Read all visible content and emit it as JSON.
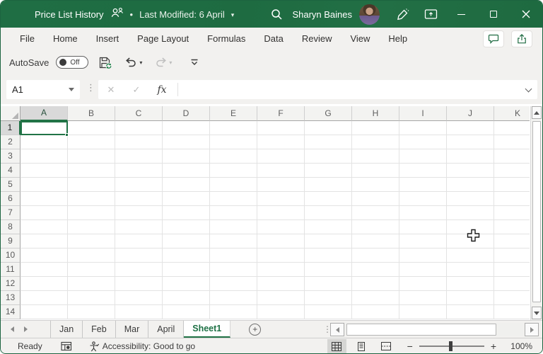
{
  "colors": {
    "brand_green": "#1e6b41",
    "accent_green": "#217346"
  },
  "glyphs": {
    "caret_down": "▾",
    "dots": "⋮",
    "bullet": "•"
  },
  "titlebar": {
    "title": "Price List History",
    "bullet": "•",
    "last_modified": "Last Modified: 6 April",
    "user_name": "Sharyn Baines"
  },
  "menu": {
    "items": [
      "File",
      "Home",
      "Insert",
      "Page Layout",
      "Formulas",
      "Data",
      "Review",
      "View",
      "Help"
    ]
  },
  "quick_access": {
    "autosave_label": "AutoSave",
    "autosave_state": "Off"
  },
  "formula_bar": {
    "name_box_value": "A1",
    "cancel_glyph": "✕",
    "enter_glyph": "✓",
    "fx_label": "fx",
    "formula_value": ""
  },
  "grid": {
    "columns": [
      "A",
      "B",
      "C",
      "D",
      "E",
      "F",
      "G",
      "H",
      "I",
      "J",
      "K"
    ],
    "selected_column": "A",
    "rows": [
      "1",
      "2",
      "3",
      "4",
      "5",
      "6",
      "7",
      "8",
      "9",
      "10",
      "11",
      "12",
      "13",
      "14"
    ],
    "selected_row": "1",
    "selected_cell": "A1"
  },
  "sheet_tabs": {
    "tabs": [
      {
        "label": "Jan",
        "active": false
      },
      {
        "label": "Feb",
        "active": false
      },
      {
        "label": "Mar",
        "active": false
      },
      {
        "label": "April",
        "active": false
      },
      {
        "label": "Sheet1",
        "active": true
      }
    ],
    "add_sheet_label": "+"
  },
  "status_bar": {
    "ready_label": "Ready",
    "accessibility_text": "Accessibility: Good to go",
    "zoom_minus": "−",
    "zoom_plus": "+",
    "zoom_level": "100%"
  }
}
